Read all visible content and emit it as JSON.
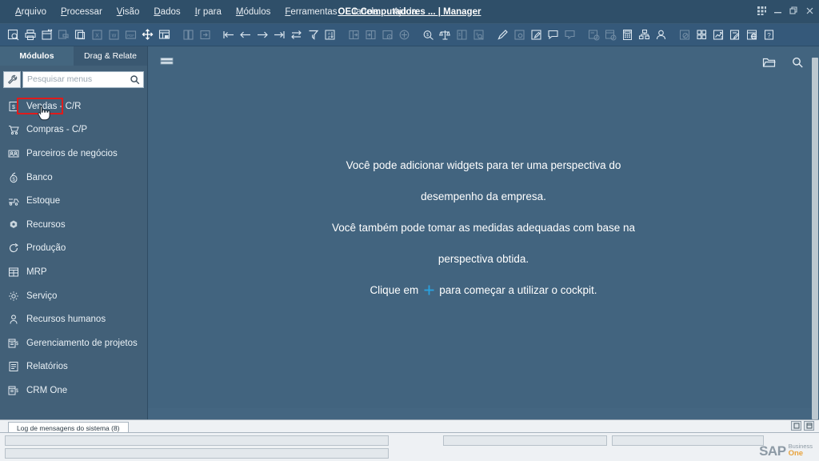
{
  "window": {
    "title": "OEC Computadores ... | Manager",
    "controls": [
      "grid",
      "minimize",
      "restore",
      "close"
    ]
  },
  "menubar": {
    "items": [
      {
        "label": "Arquivo",
        "accel": "A"
      },
      {
        "label": "Processar",
        "accel": "P"
      },
      {
        "label": "Visão",
        "accel": "V"
      },
      {
        "label": "Dados",
        "accel": "D"
      },
      {
        "label": "Ir para",
        "accel": "I"
      },
      {
        "label": "Módulos",
        "accel": "M"
      },
      {
        "label": "Ferramentas",
        "accel": "F"
      },
      {
        "label": "Janela",
        "accel": "J"
      },
      {
        "label": "Ajuda",
        "accel": "u"
      }
    ]
  },
  "toolbar": {
    "groups": [
      [
        "preview-icon",
        "print-icon",
        "print-layout-icon",
        "email-icon",
        "copy-icon",
        "excel-icon",
        "word-icon",
        "pdf-icon",
        "move-icon",
        "lock-layout-icon"
      ],
      [
        "find-icon",
        "first-record-icon",
        "previous-record-icon",
        "next-record-icon",
        "last-record-icon",
        "swap-icon",
        "filter-icon",
        "sort-icon"
      ],
      [
        "add-row-icon",
        "duplicate-row-icon",
        "gross-profit-icon",
        "volume-weight-icon"
      ],
      [
        "balance-icon",
        "payment-means-icon",
        "document-search-icon"
      ],
      [
        "edit-icon",
        "settings-doc-icon",
        "user-defined-icon",
        "message-icon",
        "message-sent-icon"
      ],
      [
        "info-doc-icon",
        "info-window-icon",
        "calculator-icon",
        "relationship-map-icon",
        "user-icon"
      ],
      [
        "restricted-icon",
        "layout-grid-icon",
        "chart-icon",
        "approval-icon",
        "browser-icon",
        "help-icon"
      ]
    ]
  },
  "sidebar": {
    "tabs": [
      {
        "label": "Módulos",
        "active": true
      },
      {
        "label": "Drag & Relate",
        "active": false
      }
    ],
    "search": {
      "placeholder": "Pesquisar menus",
      "value": "",
      "wrench_icon": "wrench-icon",
      "search_icon": "search-icon"
    },
    "modules": [
      {
        "label": "Vendas - C/R",
        "icon": "sales-icon"
      },
      {
        "label": "Compras - C/P",
        "icon": "cart-icon"
      },
      {
        "label": "Parceiros de negócios",
        "icon": "business-partners-icon"
      },
      {
        "label": "Banco",
        "icon": "bank-icon"
      },
      {
        "label": "Estoque",
        "icon": "inventory-icon"
      },
      {
        "label": "Recursos",
        "icon": "resources-icon"
      },
      {
        "label": "Produção",
        "icon": "production-icon"
      },
      {
        "label": "MRP",
        "icon": "mrp-icon"
      },
      {
        "label": "Serviço",
        "icon": "service-icon"
      },
      {
        "label": "Recursos humanos",
        "icon": "hr-icon"
      },
      {
        "label": "Gerenciamento de projetos",
        "icon": "project-management-icon"
      },
      {
        "label": "Relatórios",
        "icon": "reports-icon"
      },
      {
        "label": "CRM One",
        "icon": "crm-icon"
      }
    ]
  },
  "main": {
    "menu_icon": "hamburger-icon",
    "actions": [
      {
        "name": "open-folder-icon"
      },
      {
        "name": "search-icon"
      }
    ],
    "cockpit_message": {
      "line1": "Você pode adicionar widgets para ter uma perspectiva do",
      "line2": "desempenho da empresa.",
      "line3": "Você também pode tomar as medidas adequadas com base na",
      "line4": "perspectiva obtida.",
      "line5_before": "Clique em",
      "line5_icon": "plus-icon",
      "line5_after": "para começar a utilizar o cockpit."
    }
  },
  "status": {
    "log_tab_label": "Log de mensagens do sistema (8)",
    "window_buttons": [
      "restore-small",
      "maximize-small"
    ],
    "logo": {
      "sap": "SAP",
      "business": "Business",
      "one": "One"
    }
  },
  "colors": {
    "titlebar": "#2f4f69",
    "toolbar": "#35597a",
    "sidebar": "#426078",
    "main": "#42647f",
    "highlight": "#e01b1b",
    "plus": "#29a3e0",
    "logo_orange": "#e8a33d"
  }
}
